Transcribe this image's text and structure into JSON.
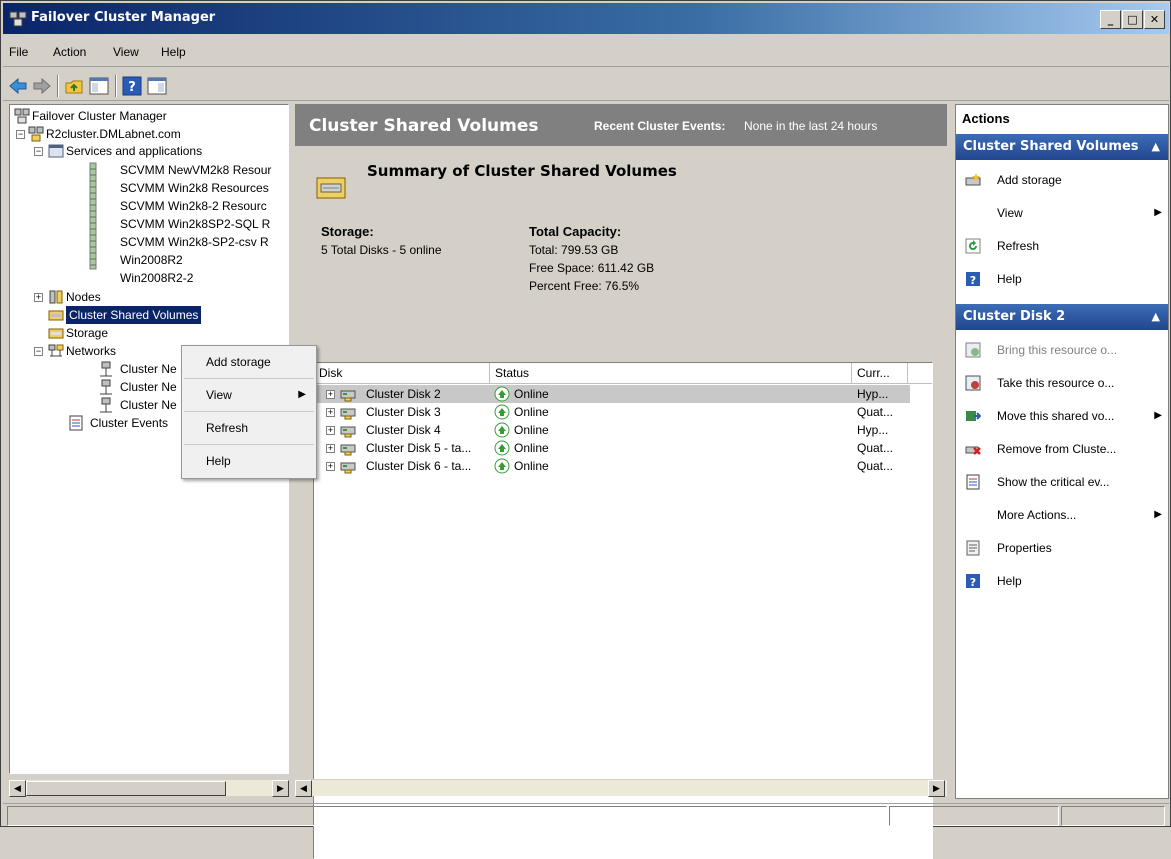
{
  "window": {
    "title": "Failover Cluster Manager",
    "min": "_",
    "max": "□",
    "close": "✕"
  },
  "menu": [
    "File",
    "Action",
    "View",
    "Help"
  ],
  "tree": {
    "root": "Failover Cluster Manager",
    "cluster": "R2cluster.DMLabnet.com",
    "services": "Services and applications",
    "services_items": [
      "SCVMM NewVM2k8 Resour",
      "SCVMM Win2k8 Resources",
      "SCVMM Win2k8-2 Resourc",
      "SCVMM Win2k8SP2-SQL R",
      "SCVMM Win2k8-SP2-csv R",
      "Win2008R2",
      "Win2008R2-2"
    ],
    "nodes": "Nodes",
    "csv": "Cluster Shared Volumes",
    "storage": "Storage",
    "networks": "Networks",
    "network_items": [
      "Cluster Ne",
      "Cluster Ne",
      "Cluster Ne"
    ],
    "events": "Cluster Events"
  },
  "context_menu": {
    "add": "Add storage",
    "view": "View",
    "refresh": "Refresh",
    "help": "Help"
  },
  "center": {
    "title": "Cluster Shared Volumes",
    "events_label": "Recent Cluster Events:",
    "events_value": "None in the last 24 hours",
    "summary_title": "Summary of Cluster Shared Volumes",
    "storage_label": "Storage:",
    "storage_value": "5 Total Disks - 5 online",
    "capacity_label": "Total Capacity:",
    "total": "Total: 799.53 GB",
    "free": "Free Space: 611.42 GB",
    "percent": "Percent Free: 76.5%"
  },
  "grid": {
    "columns": [
      "Disk",
      "Status",
      "Curr..."
    ],
    "rows": [
      {
        "disk": "Cluster Disk 2",
        "status": "Online",
        "curr": "Hyp..."
      },
      {
        "disk": "Cluster Disk 3",
        "status": "Online",
        "curr": "Quat..."
      },
      {
        "disk": "Cluster Disk 4",
        "status": "Online",
        "curr": "Hyp..."
      },
      {
        "disk": "Cluster Disk 5 - ta...",
        "status": "Online",
        "curr": "Quat..."
      },
      {
        "disk": "Cluster Disk 6 - ta...",
        "status": "Online",
        "curr": "Quat..."
      }
    ]
  },
  "actions": {
    "header": "Actions",
    "section1": "Cluster Shared Volumes",
    "s1_items": [
      "Add storage",
      "View",
      "Refresh",
      "Help"
    ],
    "section2": "Cluster Disk 2",
    "s2_items": [
      "Bring this resource o...",
      "Take this resource o...",
      "Move this shared vo...",
      "Remove from Cluste...",
      "Show the critical ev...",
      "More Actions...",
      "Properties",
      "Help"
    ]
  },
  "colors": {
    "title_bar": "#0a246a",
    "section_header": "#2c58a6",
    "center_header": "#808080",
    "online_green": "#3a9a3a"
  }
}
